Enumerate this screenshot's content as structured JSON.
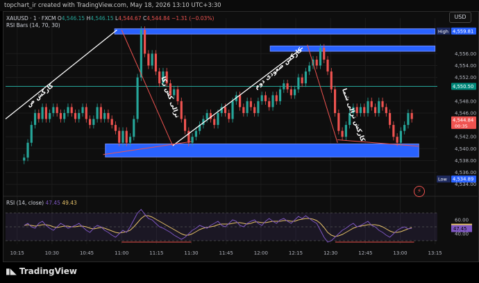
{
  "header": {
    "credit": "topchart_ir created with TradingView.com, May 18, 2026 13:10 UTC+3:30",
    "symbol": "XAUUSD · 1 · FXCM",
    "o_label": "O",
    "o_value": "4,546.15",
    "h_label": "H",
    "h_value": "4,546.15",
    "l_label": "L",
    "l_value": "4,544.67",
    "c_label": "C",
    "c_value": "4,544.84",
    "change": "−1.31 (−0.03%)",
    "rsi_bars": "RSI Bars (14, 70, 30)",
    "currency": "USD"
  },
  "footer": {
    "logo_text": "TradingView"
  },
  "colors": {
    "up": "#26a69a",
    "down": "#ef5350",
    "zone": "#2962ff",
    "rsi": "#7e57c2",
    "rsi_ma": "#e9c46a",
    "trend": "#ffffff",
    "mid_line": "#26a69a"
  },
  "chart_data": {
    "type": "candlestick",
    "x_ticks": [
      "10:15",
      "10:30",
      "10:45",
      "11:00",
      "11:15",
      "11:30",
      "11:45",
      "12:00",
      "12:15",
      "12:30",
      "12:45",
      "13:00",
      "13:15"
    ],
    "y_ticks": [
      "4,556.00",
      "4,554.00",
      "4,552.00",
      "4,548.00",
      "4,546.00",
      "4,542.00",
      "4,540.00",
      "4,538.00",
      "4,536.00",
      "4,534.00"
    ],
    "ylim": [
      4533.5,
      4560.6
    ],
    "price_labels": [
      {
        "label": "High",
        "value": 4559.81,
        "display": "4,559.81"
      },
      {
        "label": "",
        "value": 4550.5,
        "display": "4,550.50"
      },
      {
        "label": "",
        "value": 4544.84,
        "display": "4,544.84",
        "sub": "00:35"
      },
      {
        "label": "Low",
        "value": 4534.89,
        "display": "4,534.89"
      }
    ],
    "closes": [
      4538.5,
      4541,
      4544,
      4546,
      4545,
      4547,
      4545,
      4546,
      4547,
      4546,
      4545,
      4546,
      4547,
      4546,
      4545,
      4546,
      4547,
      4545,
      4544,
      4545,
      4547,
      4545,
      4546,
      4545,
      4544,
      4543,
      4541,
      4543,
      4541,
      4542,
      4545,
      4552,
      4560,
      4556,
      4554,
      4556,
      4553,
      4551,
      4553,
      4551,
      4549,
      4550,
      4548,
      4545,
      4543,
      4541,
      4542,
      4543,
      4544,
      4545,
      4546,
      4545,
      4544,
      4546,
      4547,
      4546,
      4545,
      4548,
      4549,
      4547,
      4546,
      4548,
      4547,
      4546,
      4548,
      4549,
      4548,
      4547,
      4549,
      4548,
      4550,
      4551,
      4550,
      4549,
      4550,
      4552,
      4551,
      4553,
      4554,
      4555,
      4554,
      4557,
      4555,
      4553,
      4550,
      4546,
      4543,
      4542,
      4544,
      4546,
      4547,
      4546,
      4547,
      4546,
      4548,
      4547,
      4546,
      4548,
      4547,
      4546,
      4544,
      4542,
      4541,
      4543,
      4544,
      4546,
      4545
    ],
    "zones": [
      {
        "name": "top",
        "time_start": "10:57",
        "time_end": "13:15",
        "low": 4559.3,
        "high": 4560.2
      },
      {
        "name": "upper",
        "time_start": "12:04",
        "time_end": "13:15",
        "low": 4556.4,
        "high": 4557.3
      },
      {
        "name": "lower",
        "time_start": "10:53",
        "time_end": "13:08",
        "low": 4538.6,
        "high": 4540.8
      }
    ],
    "mid_line": 4550.5,
    "annotations": [
      "کارکش ص",
      "ترالی کش رکا",
      "کارکش صعودی دوم",
      "کارکش ترالی شما"
    ],
    "rsi": {
      "label": "RSI (14, close)",
      "value": "47.45",
      "ma_value": "49.43",
      "y_ticks": [
        "60.00",
        "40.00"
      ],
      "levels": [
        70,
        50,
        30
      ],
      "ylim": [
        25,
        80
      ],
      "series": [
        52,
        55,
        50,
        48,
        55,
        58,
        52,
        48,
        45,
        50,
        55,
        52,
        48,
        50,
        52,
        55,
        50,
        45,
        42,
        48,
        52,
        50,
        45,
        42,
        38,
        35,
        40,
        45,
        42,
        50,
        60,
        70,
        75,
        68,
        62,
        60,
        55,
        50,
        48,
        45,
        42,
        38,
        35,
        32,
        35,
        40,
        45,
        48,
        52,
        50,
        48,
        52,
        55,
        58,
        52,
        50,
        55,
        60,
        58,
        52,
        50,
        55,
        58,
        60,
        55,
        52,
        58,
        62,
        58,
        55,
        60,
        62,
        58,
        55,
        60,
        65,
        62,
        66,
        62,
        58,
        55,
        45,
        35,
        28,
        30,
        35,
        40,
        45,
        48,
        52,
        55,
        50,
        52,
        55,
        58,
        52,
        50,
        45,
        42,
        38,
        35,
        40,
        45,
        48,
        50,
        47,
        48
      ],
      "ma_series": [
        52,
        53,
        52,
        51,
        52,
        53,
        53,
        52,
        50,
        49,
        50,
        51,
        51,
        50,
        50,
        51,
        51,
        50,
        48,
        47,
        48,
        49,
        48,
        46,
        44,
        42,
        41,
        42,
        43,
        45,
        50,
        56,
        62,
        66,
        66,
        64,
        61,
        58,
        55,
        52,
        49,
        46,
        43,
        40,
        38,
        38,
        40,
        43,
        46,
        48,
        49,
        50,
        51,
        53,
        54,
        54,
        54,
        55,
        56,
        56,
        55,
        54,
        55,
        57,
        57,
        56,
        56,
        57,
        58,
        58,
        58,
        59,
        59,
        58,
        58,
        60,
        61,
        62,
        62,
        61,
        59,
        55,
        49,
        42,
        38,
        36,
        37,
        39,
        42,
        45,
        48,
        50,
        51,
        52,
        53,
        53,
        53,
        52,
        50,
        47,
        44,
        42,
        42,
        43,
        45,
        47,
        49
      ]
    }
  }
}
